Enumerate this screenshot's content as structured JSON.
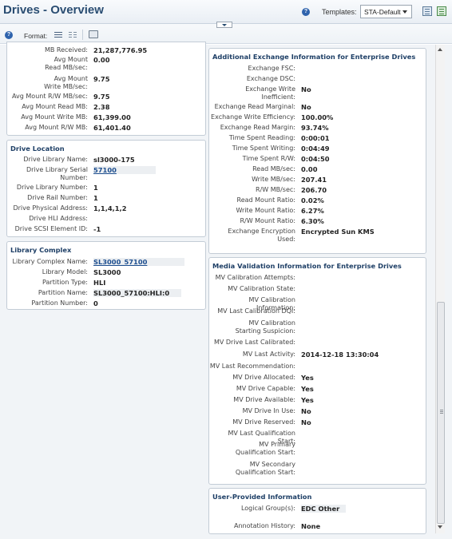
{
  "header": {
    "title": "Drives - Overview",
    "templates_label": "Templates:",
    "template_selected": "STA-Default",
    "help_glyph": "?"
  },
  "toolbar": {
    "format_label": "Format:"
  },
  "performance": {
    "rows": [
      {
        "label": "MB Received:",
        "value": "21,287,776.95"
      },
      {
        "label": "Avg Mount Read MB/sec:",
        "value": "0.00"
      },
      {
        "label": "Avg Mount Write MB/sec:",
        "value": "9.75"
      },
      {
        "label": "Avg Mount R/W MB/sec:",
        "value": "9.75"
      },
      {
        "label": "Avg Mount Read MB:",
        "value": "2.38"
      },
      {
        "label": "Avg Mount Write MB:",
        "value": "61,399.00"
      },
      {
        "label": "Avg Mount R/W MB:",
        "value": "61,401.40"
      }
    ]
  },
  "drive_location": {
    "title": "Drive Location",
    "rows": [
      {
        "label": "Drive Library Name:",
        "value": "sl3000-175"
      },
      {
        "label": "Drive Library Serial Number:",
        "value": "57100"
      },
      {
        "label": "Drive Library Number:",
        "value": "1"
      },
      {
        "label": "Drive Rail Number:",
        "value": "1"
      },
      {
        "label": "Drive Physical Address:",
        "value": "1,1,4,1,2"
      },
      {
        "label": "Drive HLI Address:",
        "value": ""
      },
      {
        "label": "Drive SCSI Element ID:",
        "value": "-1"
      }
    ]
  },
  "library_complex": {
    "title": "Library Complex",
    "rows": [
      {
        "label": "Library Complex Name:",
        "value": "SL3000_57100"
      },
      {
        "label": "Library Model:",
        "value": "SL3000"
      },
      {
        "label": "Partition Type:",
        "value": "HLI"
      },
      {
        "label": "Partition Name:",
        "value": "SL3000_57100:HLI:0"
      },
      {
        "label": "Partition Number:",
        "value": "0"
      }
    ]
  },
  "exchange_info": {
    "title": "Additional Exchange Information for Enterprise Drives",
    "rows": [
      {
        "label": "Exchange FSC:",
        "value": ""
      },
      {
        "label": "Exchange DSC:",
        "value": ""
      },
      {
        "label": "Exchange Write Inefficient:",
        "value": "No"
      },
      {
        "label": "Exchange Read Marginal:",
        "value": "No"
      },
      {
        "label": "Exchange Write Efficiency:",
        "value": "100.00%"
      },
      {
        "label": "Exchange Read Margin:",
        "value": "93.74%"
      },
      {
        "label": "Time Spent Reading:",
        "value": "0:00:01"
      },
      {
        "label": "Time Spent Writing:",
        "value": "0:04:49"
      },
      {
        "label": "Time Spent R/W:",
        "value": "0:04:50"
      },
      {
        "label": "Read MB/sec:",
        "value": "0.00"
      },
      {
        "label": "Write MB/sec:",
        "value": "207.41"
      },
      {
        "label": "R/W MB/sec:",
        "value": "206.70"
      },
      {
        "label": "Read Mount Ratio:",
        "value": "0.02%"
      },
      {
        "label": "Write Mount Ratio:",
        "value": "6.27%"
      },
      {
        "label": "R/W Mount Ratio:",
        "value": "6.30%"
      },
      {
        "label": "Exchange Encryption Used:",
        "value": "Encrypted Sun KMS"
      }
    ]
  },
  "media_validation": {
    "title": "Media Validation Information for Enterprise Drives",
    "rows": [
      {
        "label": "MV Calibration Attempts:",
        "value": ""
      },
      {
        "label": "MV Calibration State:",
        "value": ""
      },
      {
        "label": "MV Calibration Information:",
        "value": ""
      },
      {
        "label": "MV Last Calibration DQI:",
        "value": ""
      },
      {
        "label": "MV Calibration Starting Suspicion:",
        "value": ""
      },
      {
        "label": "MV Drive Last Calibrated:",
        "value": ""
      },
      {
        "label": "MV Last Activity:",
        "value": "2014-12-18 13:30:04"
      },
      {
        "label": "MV Last Recommendation:",
        "value": ""
      },
      {
        "label": "MV Drive Allocated:",
        "value": "Yes"
      },
      {
        "label": "MV Drive Capable:",
        "value": "Yes"
      },
      {
        "label": "MV Drive Available:",
        "value": "Yes"
      },
      {
        "label": "MV Drive In Use:",
        "value": "No"
      },
      {
        "label": "MV Drive Reserved:",
        "value": "No"
      },
      {
        "label": "MV Last Qualification Start:",
        "value": ""
      },
      {
        "label": "MV Primary Qualification Start:",
        "value": ""
      },
      {
        "label": "MV Secondary Qualification Start:",
        "value": ""
      }
    ]
  },
  "user_info": {
    "title": "User-Provided Information",
    "rows": [
      {
        "label": "Logical Group(s):",
        "value": "EDC Other"
      },
      {
        "label": "Annotation History:",
        "value": "None"
      }
    ]
  }
}
